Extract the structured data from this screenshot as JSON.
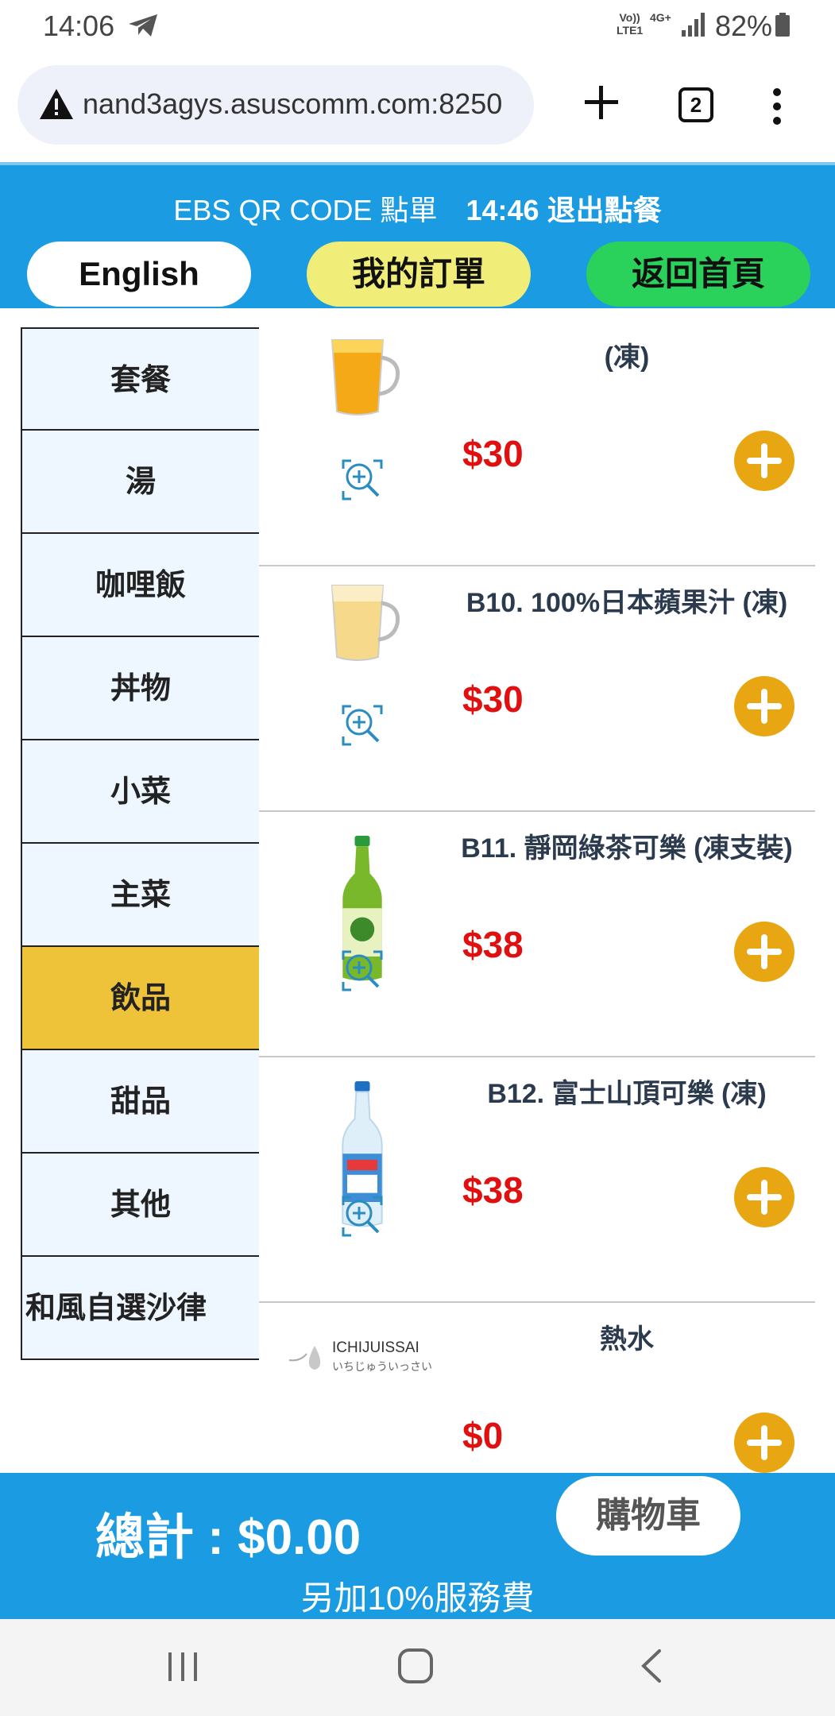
{
  "status_bar": {
    "time": "14:06",
    "network_volte": "Vo))\nLTE1",
    "network_type": "4G+",
    "battery": "82%",
    "icons": [
      "telegram-icon",
      "signal-icon",
      "battery-icon"
    ]
  },
  "browser": {
    "url": "nand3agys.asuscomm.com:8250",
    "tabs_count": "2",
    "icons": [
      "warning-icon",
      "new-tab-icon",
      "menu-icon"
    ]
  },
  "header": {
    "title": "EBS QR CODE 點單",
    "session": "14:46 退出點餐",
    "btn_english": "English",
    "btn_order": "我的訂單",
    "btn_home": "返回首頁"
  },
  "categories": [
    {
      "label": "套餐"
    },
    {
      "label": "湯"
    },
    {
      "label": "咖哩飯"
    },
    {
      "label": "丼物"
    },
    {
      "label": "小菜"
    },
    {
      "label": "主菜"
    },
    {
      "label": "飲品",
      "active": true
    },
    {
      "label": "甜品"
    },
    {
      "label": "其他"
    },
    {
      "label": "和風自選沙律"
    }
  ],
  "products": [
    {
      "name": "(凍)",
      "price": "$30"
    },
    {
      "name": "B10. 100%日本蘋果汁 (凍)",
      "price": "$30"
    },
    {
      "name": "B11. 靜岡綠茶可樂 (凍支裝)",
      "price": "$38"
    },
    {
      "name": "B12. 富士山頂可樂 (凍)",
      "price": "$38"
    },
    {
      "name": "熱水",
      "price": "$0",
      "logo_text": "ICHIJUISSAI",
      "logo_sub": "いちじゅういっさい"
    }
  ],
  "footer": {
    "total": "總計 : $0.00",
    "cart": "購物車",
    "service_note": "另加10%服務費"
  },
  "colors": {
    "header_blue": "#1a9be2",
    "active_category": "#eec33a",
    "price_red": "#e01010",
    "add_button": "#e8a712"
  }
}
